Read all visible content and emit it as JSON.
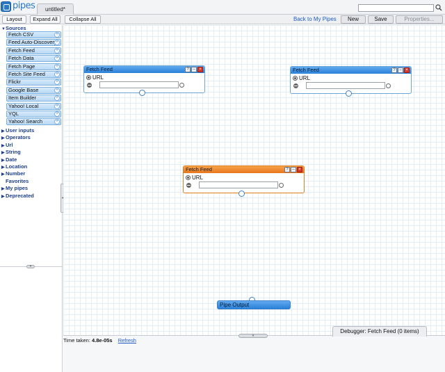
{
  "header": {
    "logo_text": "pipes",
    "doc_tab": "untitled*",
    "search_placeholder": ""
  },
  "toolbar": {
    "layout": "Layout",
    "expand_all": "Expand All",
    "collapse_all": "Collapse All",
    "back_link": "Back to My Pipes",
    "new": "New",
    "save": "Save",
    "properties": "Properties..."
  },
  "sidebar": {
    "sources_label": "Sources",
    "sources": [
      "Fetch CSV",
      "Feed Auto-Discovery",
      "Fetch Feed",
      "Fetch Data",
      "Fetch Page",
      "Fetch Site Feed",
      "Flickr",
      "Google Base",
      "Item Builder",
      "Yahoo! Local",
      "YQL",
      "Yahoo! Search"
    ],
    "categories": [
      "User inputs",
      "Operators",
      "Url",
      "String",
      "Date",
      "Location",
      "Number"
    ],
    "favorites": "Favorites",
    "more": [
      "My pipes",
      "Deprecated"
    ]
  },
  "canvas": {
    "modules": [
      {
        "title": "Fetch Feed",
        "field_label": "URL",
        "url_value": ""
      },
      {
        "title": "Fetch Feed",
        "field_label": "URL",
        "url_value": ""
      },
      {
        "title": "Fetch Feed",
        "field_label": "URL",
        "url_value": ""
      }
    ],
    "pipe_output": "Pipe Output",
    "module_buttons": {
      "help": "?",
      "minimize": "–",
      "close": "×"
    }
  },
  "debugger": {
    "tab_label": "Debugger: Fetch Feed (0 items)",
    "time_label": "Time taken:",
    "time_value": "4.8e-05s",
    "refresh": "Refresh"
  },
  "colors": {
    "accent_blue": "#2a80d8",
    "selected_orange": "#e8771c",
    "link": "#1f5bc0"
  }
}
